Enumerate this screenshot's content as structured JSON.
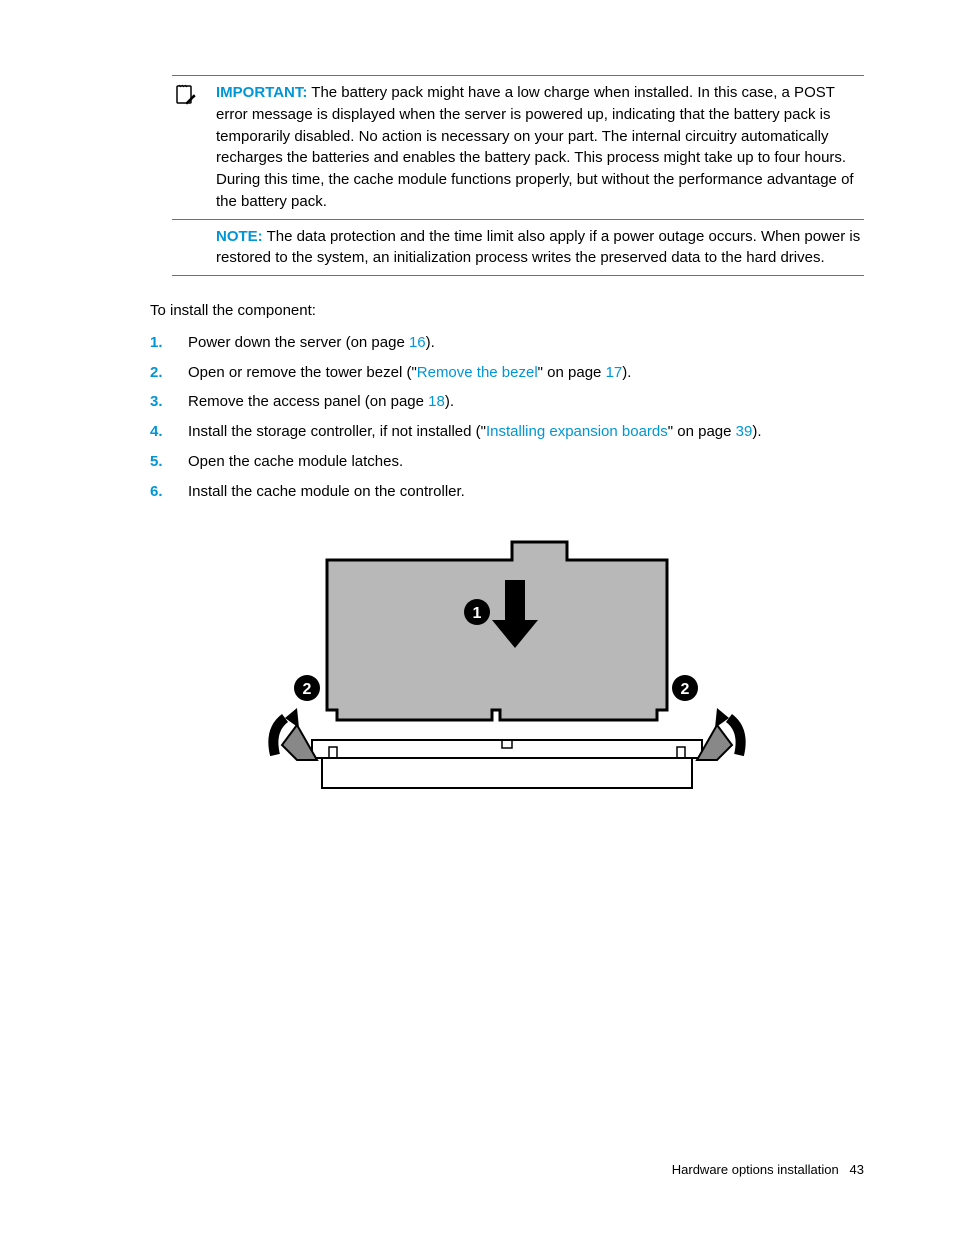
{
  "callouts": {
    "important": {
      "label": "IMPORTANT:",
      "text": "The battery pack might have a low charge when installed. In this case, a POST error message is displayed when the server is powered up, indicating that the battery pack is temporarily disabled. No action is necessary on your part. The internal circuitry automatically recharges the batteries and enables the battery pack. This process might take up to four hours. During this time, the cache module functions properly, but without the performance advantage of the battery pack."
    },
    "note": {
      "label": "NOTE:",
      "text": "The data protection and the time limit also apply if a power outage occurs. When power is restored to the system, an initialization process writes the preserved data to the hard drives."
    }
  },
  "intro": "To install the component:",
  "steps": [
    {
      "pre": "Power down the server (on page ",
      "link": "16",
      "post": ")."
    },
    {
      "pre": "Open or remove the tower bezel (\"",
      "link": "Remove the bezel",
      "mid": "\" on page ",
      "link2": "17",
      "post": ")."
    },
    {
      "pre": "Remove the access panel (on page ",
      "link": "18",
      "post": ")."
    },
    {
      "pre": "Install the storage controller, if not installed (\"",
      "link": "Installing expansion boards",
      "mid": "\" on page ",
      "link2": "39",
      "post": ")."
    },
    {
      "pre": "Open the cache module latches."
    },
    {
      "pre": "Install the cache module on the controller."
    }
  ],
  "diagram": {
    "callout1": "1",
    "callout2_left": "2",
    "callout2_right": "2"
  },
  "footer": {
    "section": "Hardware options installation",
    "page": "43"
  }
}
